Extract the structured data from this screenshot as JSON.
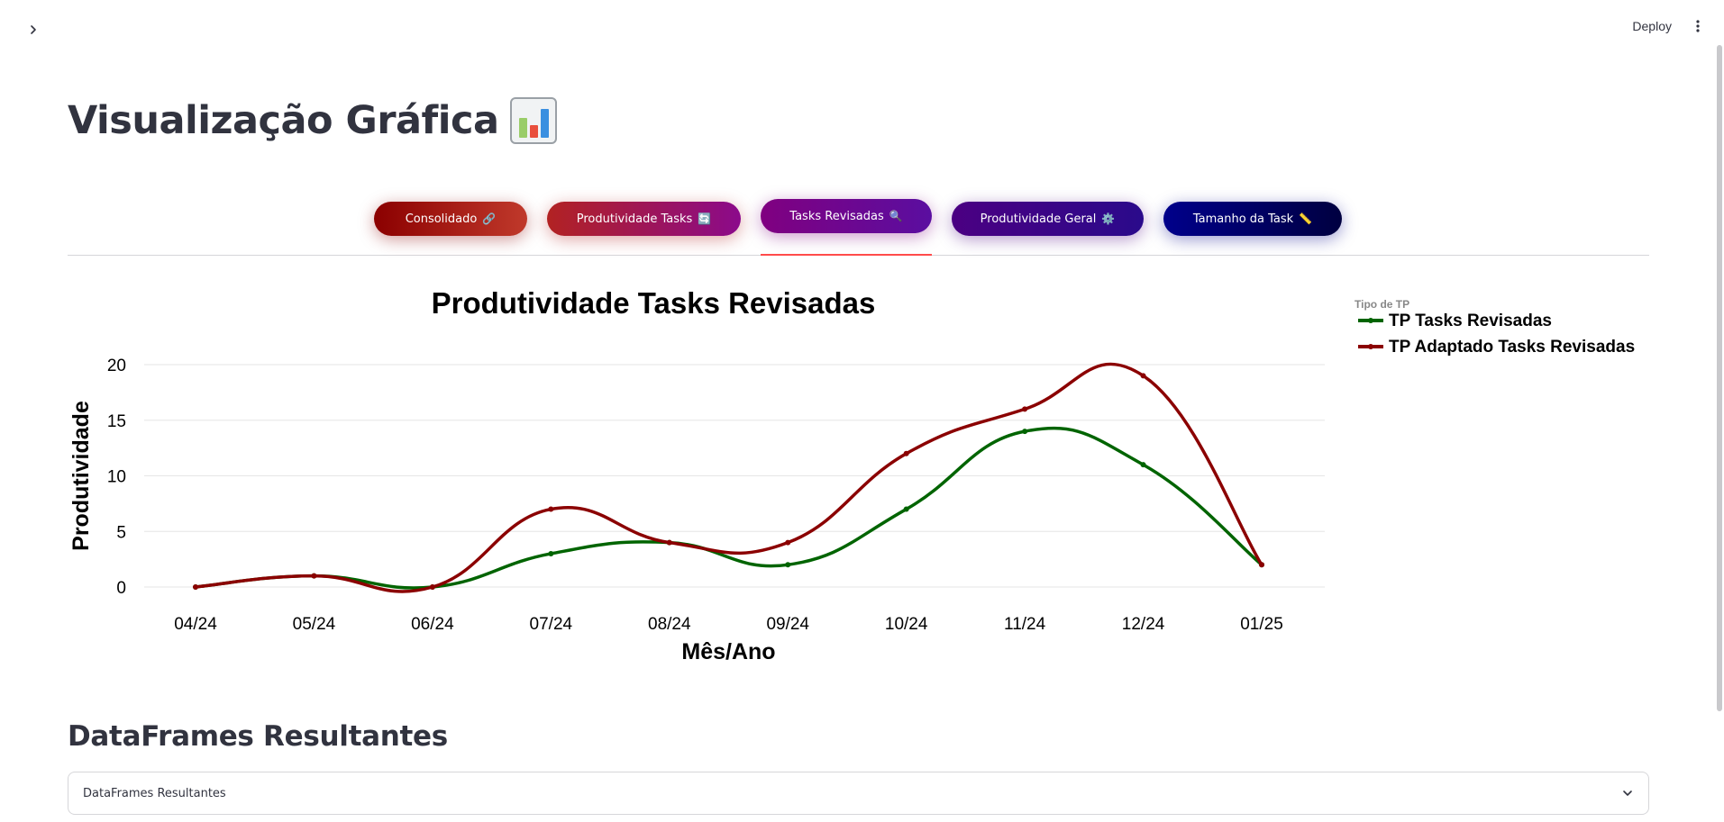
{
  "header": {
    "deploy_label": "Deploy",
    "sidebar_toggle_icon": "chevron-right-icon",
    "menu_icon": "vertical-dots-icon"
  },
  "page": {
    "title": "Visualização Gráfica",
    "title_icon": "bar-chart-icon"
  },
  "tabs": [
    {
      "label": "Consolidado",
      "icon": "link-icon",
      "glyph": "🔗",
      "active": false,
      "color_from": "#8b0000",
      "color_to": "#c0392b"
    },
    {
      "label": "Produtividade Tasks",
      "icon": "refresh-icon",
      "glyph": "🔄",
      "active": false,
      "color_from": "#b22222",
      "color_to": "#8b0a8b"
    },
    {
      "label": "Tasks Revisadas",
      "icon": "magnifier-icon",
      "glyph": "🔍",
      "active": true,
      "color_from": "#800080",
      "color_to": "#5a0ea0"
    },
    {
      "label": "Produtividade Geral",
      "icon": "gear-icon",
      "glyph": "⚙️",
      "active": false,
      "color_from": "#4b0082",
      "color_to": "#2a0a8b"
    },
    {
      "label": "Tamanho da Task",
      "icon": "ruler-icon",
      "glyph": "📏",
      "active": false,
      "color_from": "#00008b",
      "color_to": "#000040"
    }
  ],
  "chart_data": {
    "type": "line",
    "title": "Produtividade Tasks Revisadas",
    "xlabel": "Mês/Ano",
    "ylabel": "Produtividade",
    "categories": [
      "04/24",
      "05/24",
      "06/24",
      "07/24",
      "08/24",
      "09/24",
      "10/24",
      "11/24",
      "12/24",
      "01/25"
    ],
    "ylim": [
      0,
      20
    ],
    "yticks": [
      0,
      5,
      10,
      15,
      20
    ],
    "grid": true,
    "legend_title": "Tipo de TP",
    "legend_position": "right",
    "series": [
      {
        "name": "TP Tasks Revisadas",
        "color": "#006400",
        "values": [
          0,
          1,
          0,
          3,
          4,
          2,
          7,
          14,
          11,
          2
        ]
      },
      {
        "name": "TP Adaptado Tasks Revisadas",
        "color": "#8b0000",
        "values": [
          0,
          1,
          0,
          7,
          4,
          4,
          12,
          16,
          19,
          2
        ]
      }
    ]
  },
  "section": {
    "title": "DataFrames Resultantes",
    "expander_label": "DataFrames Resultantes",
    "expander_icon": "chevron-down-icon"
  }
}
